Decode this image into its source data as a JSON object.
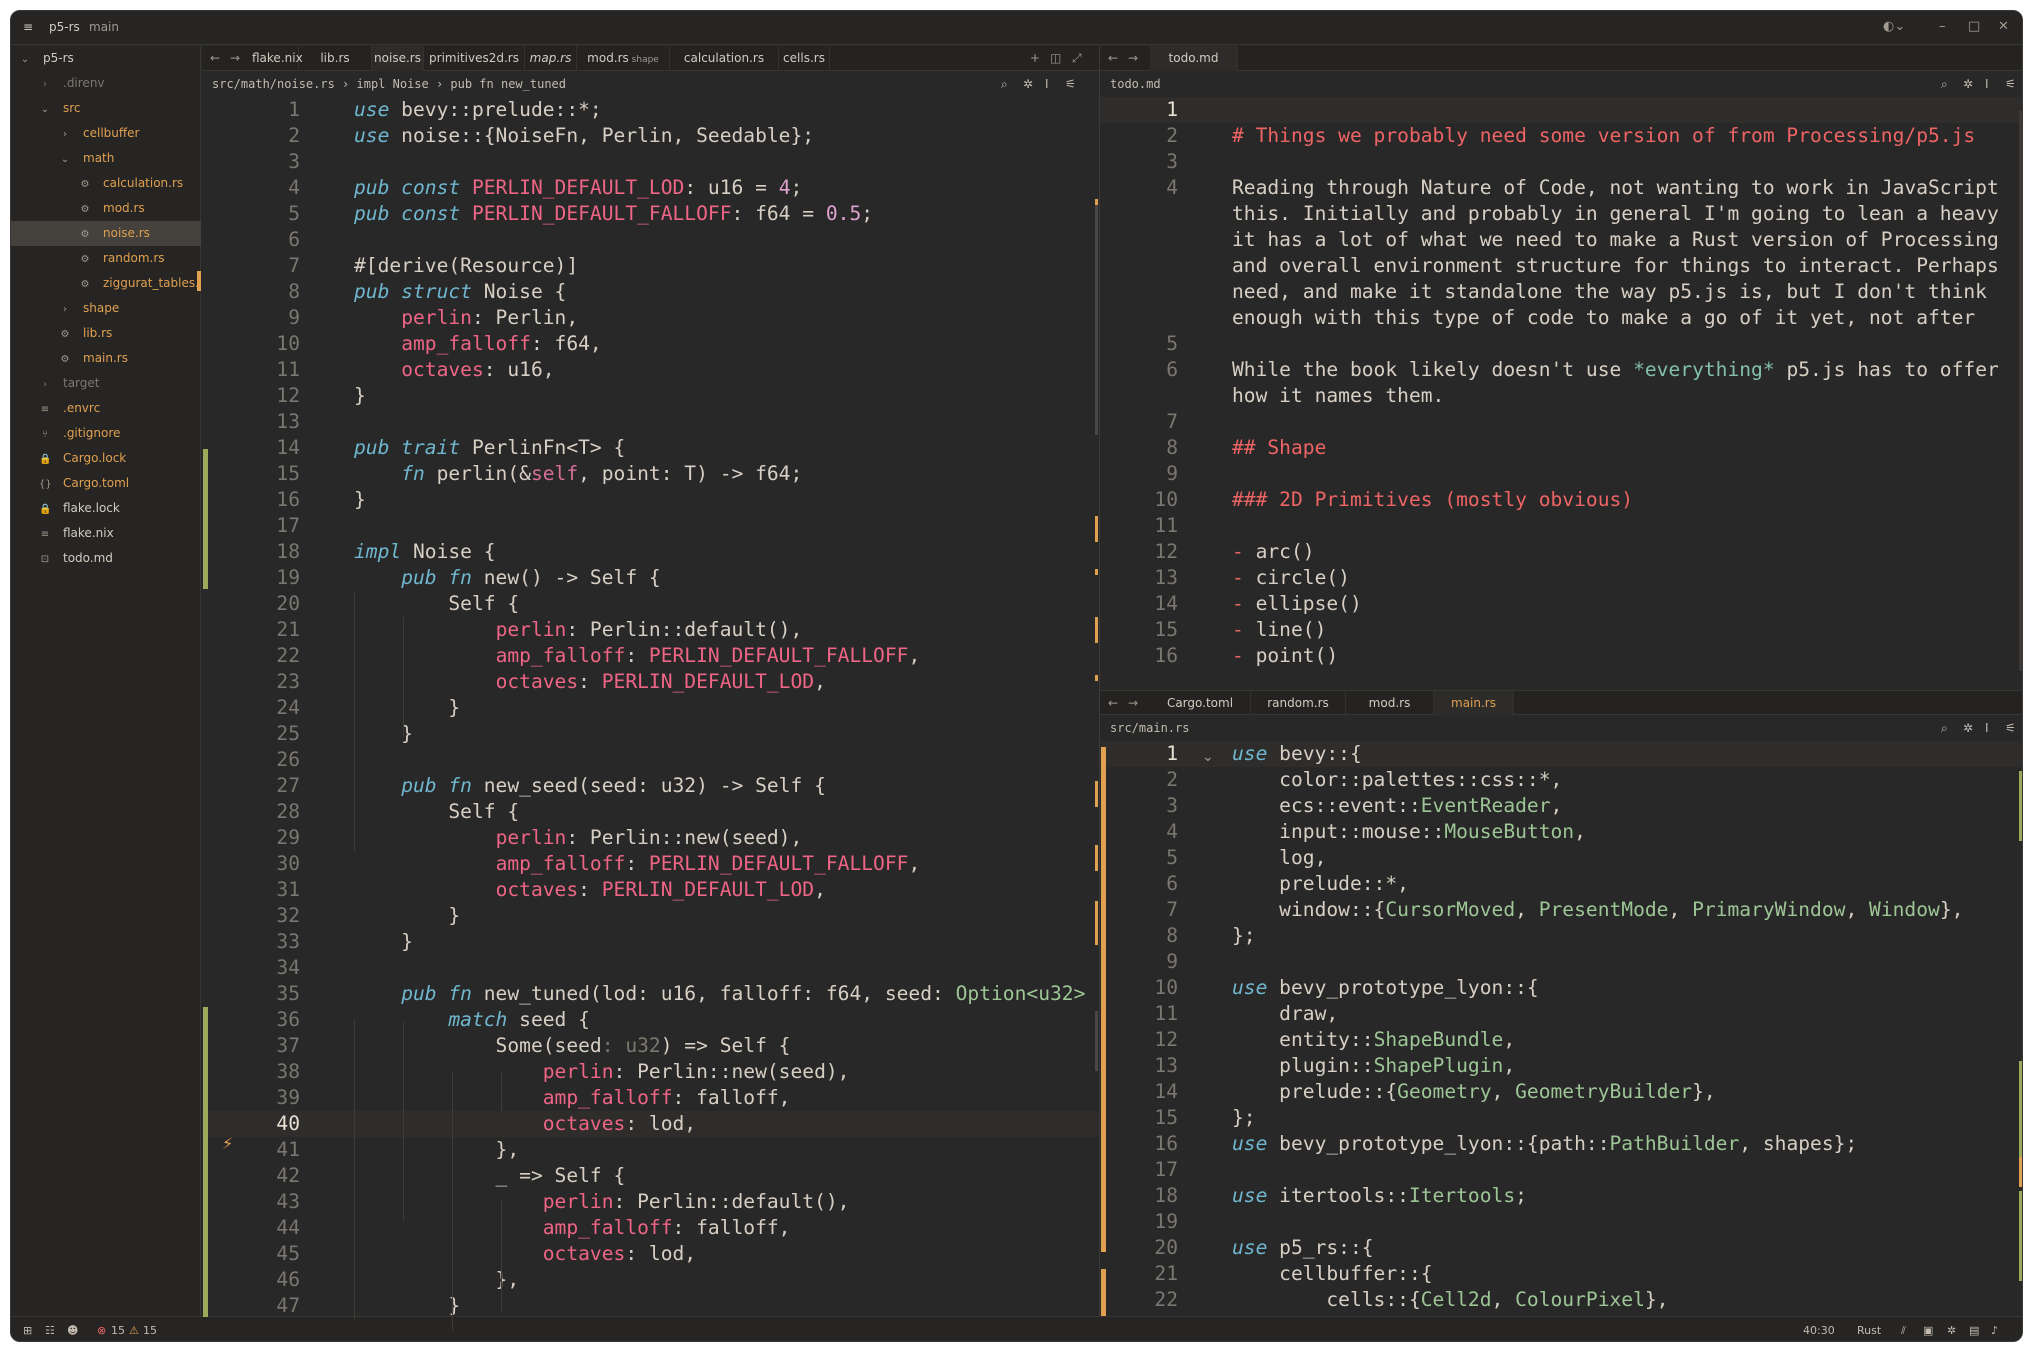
{
  "titlebar": {
    "project": "p5-rs",
    "branch": "main",
    "min": "–",
    "max": "□",
    "close": "✕",
    "avatar": "◐⌄"
  },
  "sidebar": {
    "items": [
      {
        "label": "p5-rs",
        "icon": "⌄",
        "color": "#d3cbc0"
      },
      {
        "label": ".direnv",
        "icon": "›",
        "color": "#7c776f"
      },
      {
        "label": "src",
        "icon": "⌄",
        "color": "#e0a050"
      },
      {
        "label": "cellbuffer",
        "icon": "›",
        "color": "#e0a050"
      },
      {
        "label": "math",
        "icon": "⌄",
        "color": "#e0a050"
      },
      {
        "label": "calculation.rs",
        "icon": "⚙",
        "color": "#e0a050"
      },
      {
        "label": "mod.rs",
        "icon": "⚙",
        "color": "#e0a050"
      },
      {
        "label": "noise.rs",
        "icon": "⚙",
        "color": "#e0a050"
      },
      {
        "label": "random.rs",
        "icon": "⚙",
        "color": "#e0a050"
      },
      {
        "label": "ziggurat_tables.rs",
        "icon": "⚙",
        "color": "#e0a050"
      },
      {
        "label": "shape",
        "icon": "›",
        "color": "#e0a050"
      },
      {
        "label": "lib.rs",
        "icon": "⚙",
        "color": "#e0a050"
      },
      {
        "label": "main.rs",
        "icon": "⚙",
        "color": "#e0a050"
      },
      {
        "label": "target",
        "icon": "›",
        "color": "#7c776f"
      },
      {
        "label": ".envrc",
        "icon": "≡",
        "color": "#e0a050"
      },
      {
        "label": ".gitignore",
        "icon": "⑂",
        "color": "#e0a050"
      },
      {
        "label": "Cargo.lock",
        "icon": "🔒",
        "color": "#e0a050"
      },
      {
        "label": "Cargo.toml",
        "icon": "{}",
        "color": "#e0a050"
      },
      {
        "label": "flake.lock",
        "icon": "🔒",
        "color": "#d3cbc0"
      },
      {
        "label": "flake.nix",
        "icon": "≡",
        "color": "#d3cbc0"
      },
      {
        "label": "todo.md",
        "icon": "⊡",
        "color": "#d3cbc0"
      }
    ]
  },
  "left_pane": {
    "tabs": [
      "flake.nix",
      "lib.rs",
      "noise.rs",
      "primitives2d.rs",
      "map.rs",
      "mod.rs",
      "calculation.rs",
      "cells.rs"
    ],
    "mod_tab_hint": "shape",
    "breadcrumb": "src/math/noise.rs › impl Noise › pub fn new_tuned"
  },
  "top_right_pane": {
    "tab": "todo.md",
    "breadcrumb": "todo.md"
  },
  "bottom_right_pane": {
    "tabs": [
      "Cargo.toml",
      "random.rs",
      "mod.rs",
      "main.rs"
    ],
    "breadcrumb": "src/main.rs"
  },
  "status": {
    "errors": "15",
    "warnings": "15",
    "cursor": "40:30",
    "language": "Rust"
  }
}
